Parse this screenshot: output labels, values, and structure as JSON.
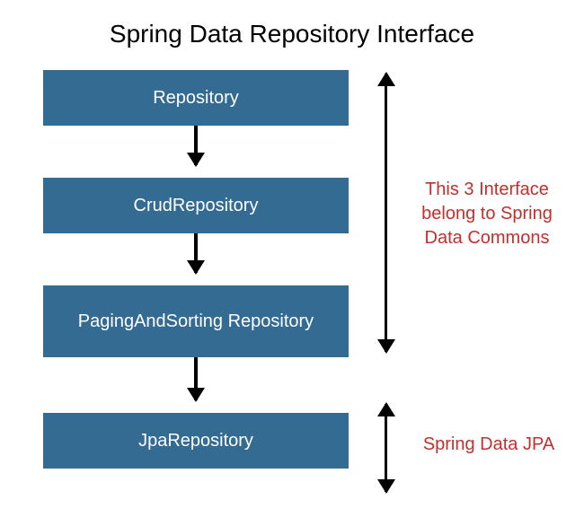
{
  "title": "Spring Data Repository Interface",
  "boxes": {
    "b1": "Repository",
    "b2": "CrudRepository",
    "b3": "PagingAndSorting Repository",
    "b4": "JpaRepository"
  },
  "annotations": {
    "commons": "This 3 Interface belong to Spring Data Commons",
    "jpa": "Spring Data JPA"
  },
  "colors": {
    "box_bg": "#336b92",
    "box_text": "#ffffff",
    "annotation_text": "#c0302c",
    "arrow": "#000000"
  }
}
